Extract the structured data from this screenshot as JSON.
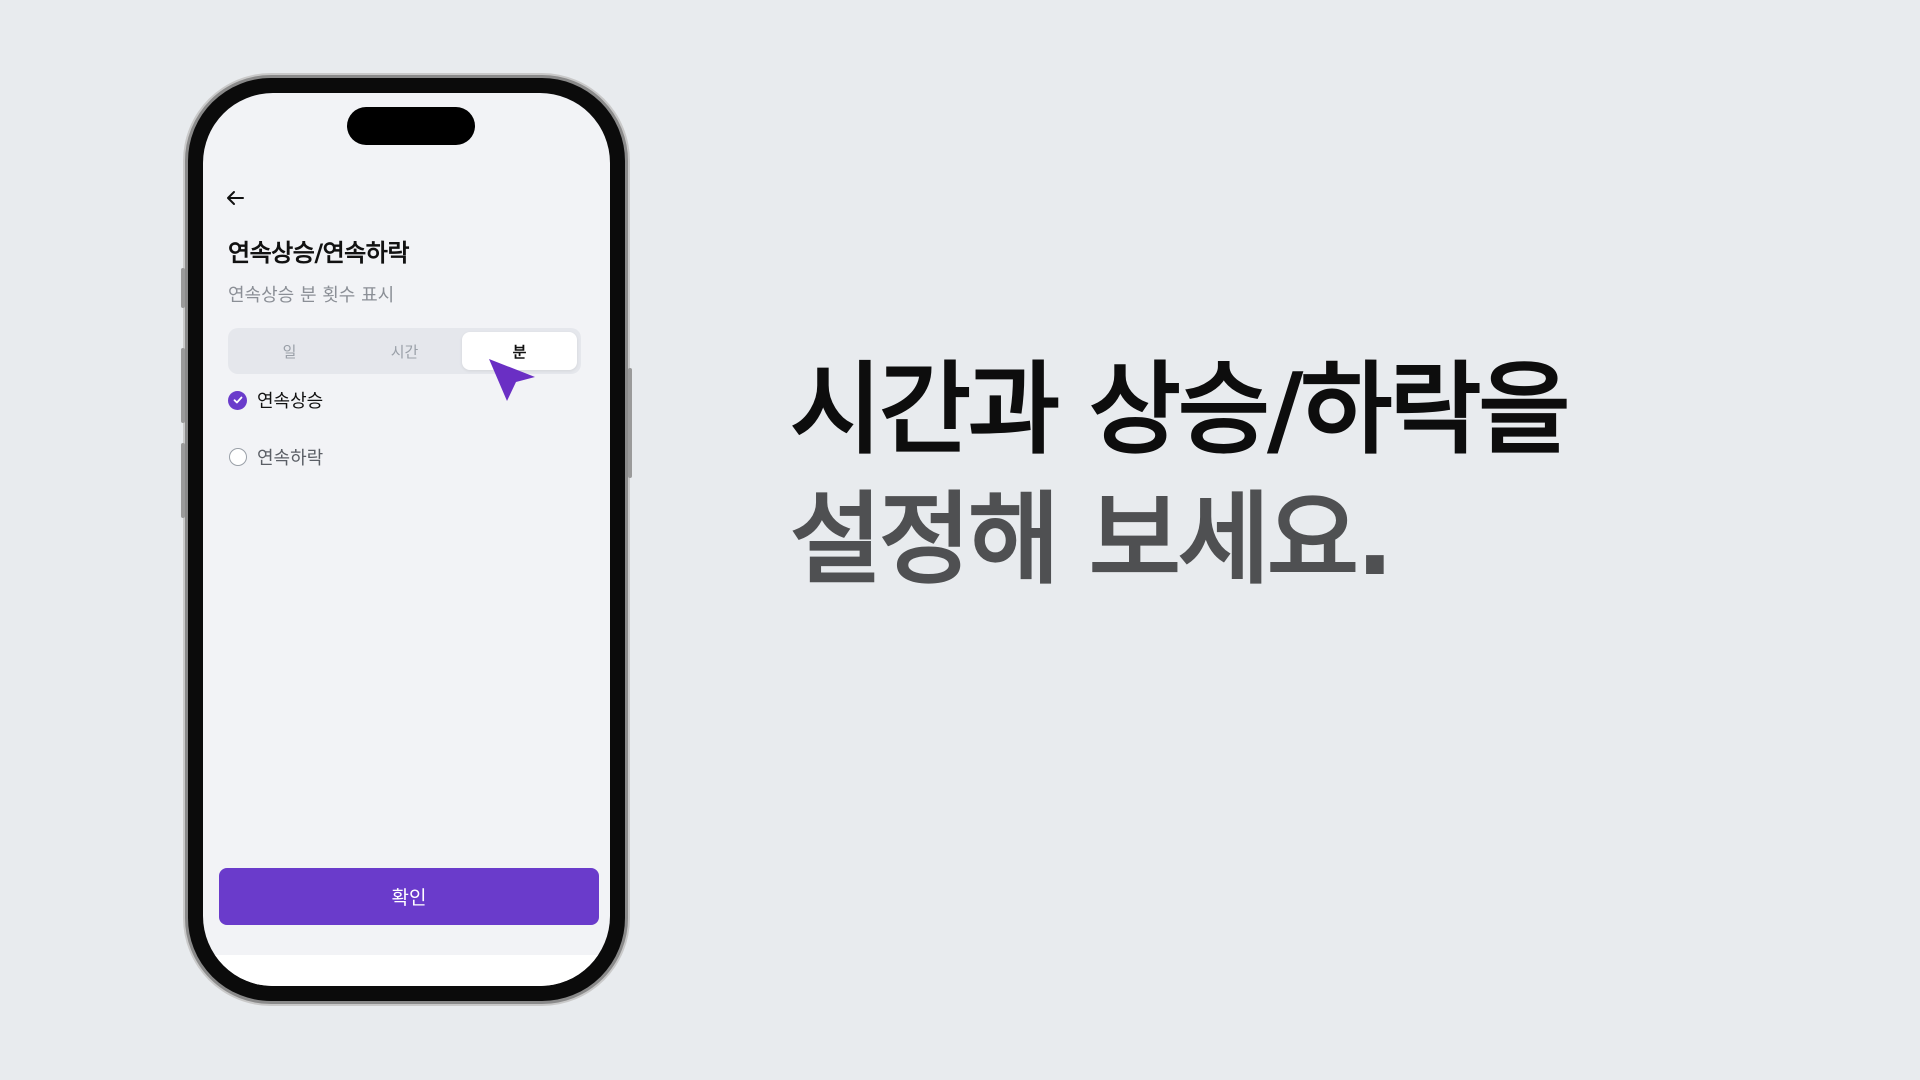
{
  "screen": {
    "title": "연속상승/연속하락",
    "subtitle": "연속상승 분 횟수 표시",
    "segments": [
      "일",
      "시간",
      "분"
    ],
    "selected_segment": "분",
    "options": [
      {
        "label": "연속상승",
        "selected": true
      },
      {
        "label": "연속하락",
        "selected": false
      }
    ],
    "confirm_label": "확인"
  },
  "headline": {
    "line1": "시간과 상승/하락을",
    "line2": "설정해 보세요."
  },
  "colors": {
    "accent": "#6a3bcb",
    "background": "#e8ebee",
    "headline_primary": "#0d0d0d",
    "headline_secondary": "#4f5052"
  },
  "icons": {
    "back": "arrow-left-icon",
    "cursor": "pointer-cursor-icon",
    "check": "check-icon"
  }
}
